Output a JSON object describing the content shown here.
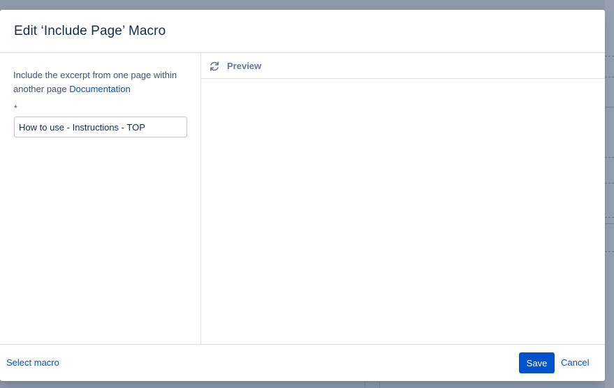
{
  "dialog": {
    "title": "Edit ‘Include Page’ Macro"
  },
  "left_pane": {
    "description": "Include the excerpt from one page within another page",
    "documentation_link": "Documentation",
    "required_marker": "*",
    "page_input": {
      "value": "How to use - Instructions - TOP",
      "placeholder": ""
    }
  },
  "right_pane": {
    "preview_label": "Preview",
    "refresh_icon": "refresh-icon"
  },
  "footer": {
    "select_macro_label": "Select macro",
    "save_label": "Save",
    "cancel_label": "Cancel"
  },
  "colors": {
    "accent": "#0052cc",
    "overlay": "#8993a4",
    "text_primary": "#172b4d",
    "text_secondary": "#42526e"
  }
}
